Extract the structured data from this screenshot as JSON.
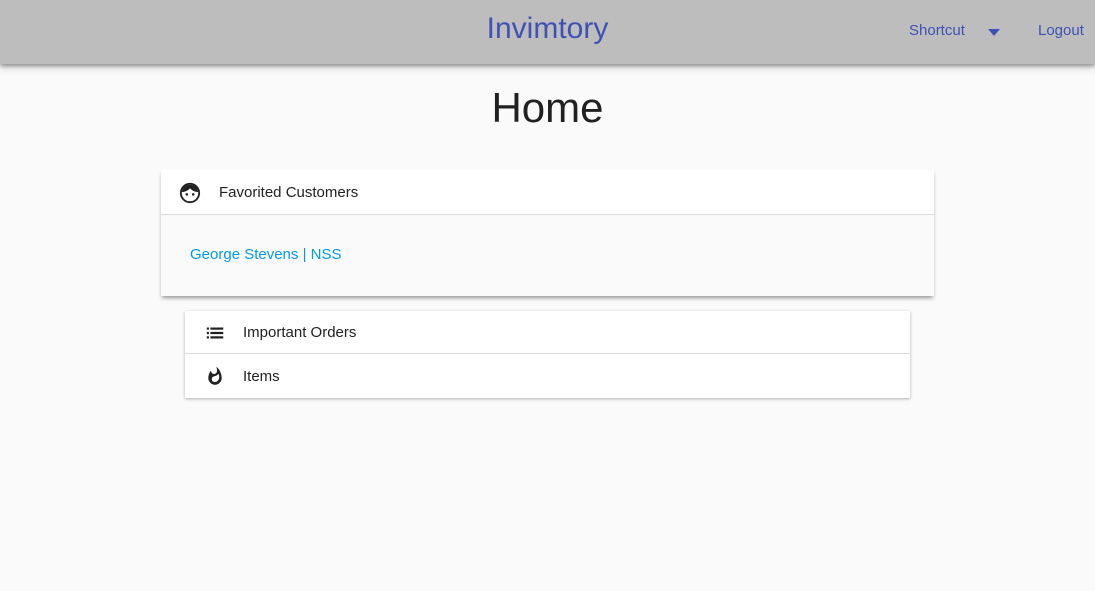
{
  "navbar": {
    "brand": "Invimtory",
    "shortcut_label": "Shortcut",
    "logout_label": "Logout",
    "accent_color": "#3f51b5",
    "background_color": "#bdbdbd"
  },
  "page": {
    "title": "Home"
  },
  "favorites": {
    "header_label": "Favorited Customers",
    "header_icon": "face-icon",
    "customers": [
      {
        "label": "George Stevens | NSS"
      }
    ],
    "link_color": "#039be5"
  },
  "quick_links": [
    {
      "label": "Important Orders",
      "icon": "list-icon"
    },
    {
      "label": "Items",
      "icon": "whatshot-icon"
    }
  ]
}
